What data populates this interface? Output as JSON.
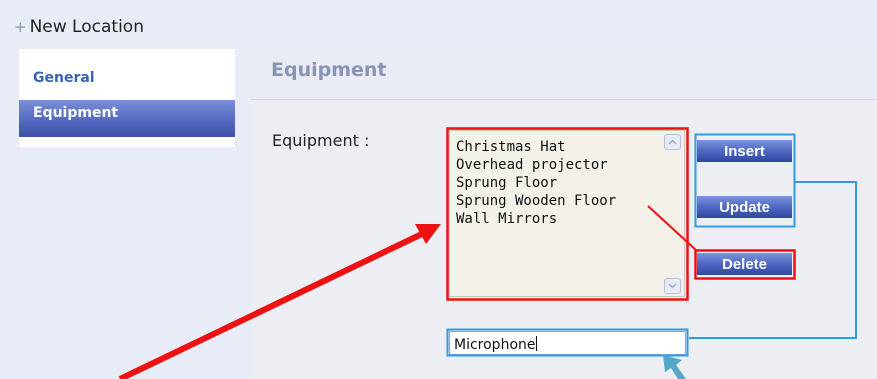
{
  "window": {
    "title": "New Location",
    "plus_icon": "+"
  },
  "sidebar": {
    "items": [
      {
        "label": "General",
        "selected": false
      },
      {
        "label": "Equipment",
        "selected": true
      }
    ]
  },
  "main": {
    "section_title": "Equipment",
    "field_label": "Equipment  :",
    "equipment_list": [
      "Christmas Hat",
      "Overhead projector",
      "Sprung Floor",
      "Sprung Wooden Floor",
      "Wall Mirrors"
    ],
    "buttons": {
      "insert": "Insert",
      "update": "Update",
      "delete": "Delete"
    },
    "input_value": "Microphone"
  },
  "colors": {
    "annotation_red": "#ee1111",
    "annotation_blue": "#2e9be8",
    "cursor_teal": "#54a8c6",
    "button_blue": "#4f67c2"
  },
  "icons": {
    "scroll_up": "chevron-up-icon",
    "scroll_down": "chevron-down-icon"
  }
}
